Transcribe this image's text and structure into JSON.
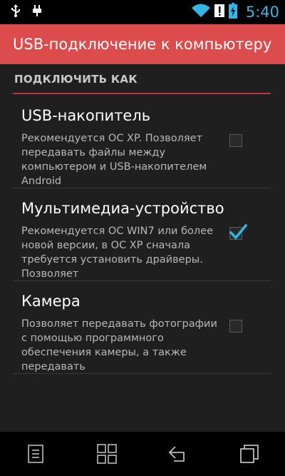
{
  "status_bar": {
    "time": "5:40",
    "icons": [
      "usb-icon",
      "notification-icon",
      "wifi-icon",
      "alert-icon",
      "battery-charging-icon"
    ]
  },
  "title": "USB-подключение к компьютеру",
  "section": {
    "header": "ПОДКЛЮЧИТЬ КАК"
  },
  "options": [
    {
      "title": "USB-накопитель",
      "summary": "Рекомендуется ОС XP. Позволяет передавать файлы между компьютером и USB-накопителем Android",
      "checked": false
    },
    {
      "title": "Мультимедиа-устройство",
      "summary": "Рекомендуется ОС WIN7 или более новой версии, в ОС XP сначала требуется установить драйверы. Позволяет",
      "checked": true
    },
    {
      "title": "Камера",
      "summary": "Позволяет передавать фотографии с помощью программного обеспечения камеры, а также передавать",
      "checked": false
    }
  ],
  "nav": [
    "menu-icon",
    "home-icon",
    "back-icon",
    "recents-icon"
  ],
  "colors": {
    "accent_red": "#dc4c4c",
    "divider_red": "#c0313a",
    "check_blue": "#33b5e5",
    "time_blue": "#33b5e5"
  }
}
